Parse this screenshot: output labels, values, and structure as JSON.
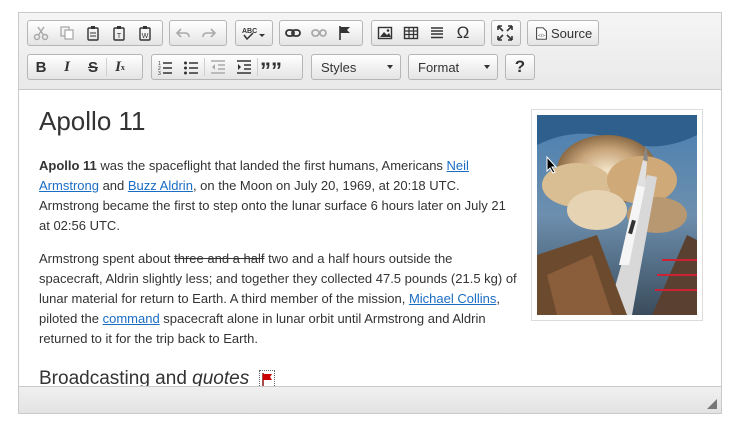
{
  "toolbar": {
    "source_label": "Source",
    "styles_label": "Styles",
    "format_label": "Format",
    "help_label": "?",
    "quote_label": "””"
  },
  "content": {
    "title": "Apollo 11",
    "p1": {
      "bold": "Apollo 11",
      "t1": " was the spaceflight that landed the first humans, Americans ",
      "link1": "Neil Armstrong",
      "t2": " and ",
      "link2": "Buzz Aldrin",
      "t3": ", on the Moon on July 20, 1969, at 20:18 UTC. Armstrong became the first to step onto the lunar surface 6 hours later on July 21 at 02:56 UTC."
    },
    "p2": {
      "t1": "Armstrong spent about ",
      "strike": "three and a half",
      "t2": " two and a half hours outside the spacecraft, Aldrin slightly less; and together they collected 47.5 pounds (21.5 kg) of lunar material for return to Earth. A third member of the mission, ",
      "link1": "Michael Collins",
      "t3": ", piloted the ",
      "link2": "command",
      "t4": " spacecraft alone in lunar orbit until Armstrong and Aldrin returned to it for the trip back to Earth."
    },
    "h2": {
      "plain": "Broadcasting and ",
      "italic": "quotes"
    }
  },
  "colors": {
    "link": "#1a6dc4",
    "flag": "#cc0000"
  }
}
